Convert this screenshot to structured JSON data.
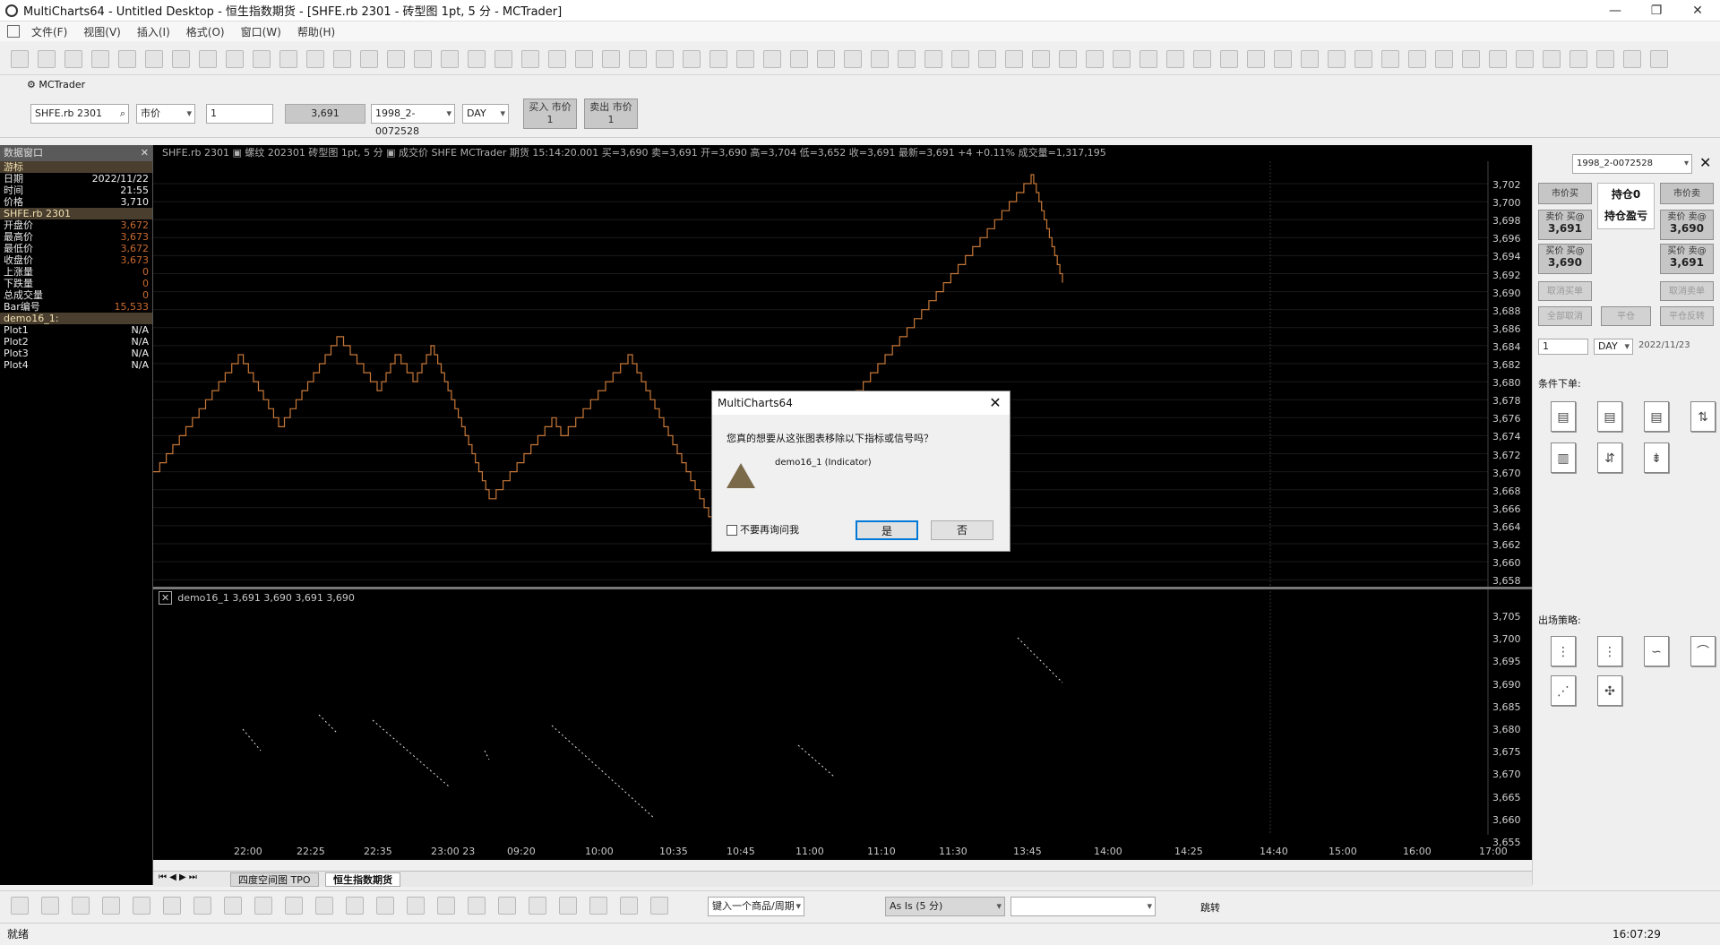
{
  "window": {
    "title": "MultiCharts64 - Untitled Desktop - 恒生指数期货 - [SHFE.rb 2301 - 砖型图 1pt, 5 分 - MCTrader]"
  },
  "menu": [
    "文件(F)",
    "视图(V)",
    "插入(I)",
    "格式(O)",
    "窗口(W)",
    "帮助(H)"
  ],
  "trade_bar": {
    "tab_label": "MCTrader",
    "symbol": "SHFE.rb 2301",
    "order_type": "市价",
    "quantity": "1",
    "price": "3,691",
    "account": "1998_2-0072528",
    "tif": "DAY",
    "buy_label": "买入 市价",
    "buy_qty": "1",
    "sell_label": "卖出 市价",
    "sell_qty": "1"
  },
  "data_window": {
    "title": "数据窗口",
    "rows": [
      {
        "label": "游标",
        "value": "",
        "section": true
      },
      {
        "label": "日期",
        "value": "2022/11/22"
      },
      {
        "label": "时间",
        "value": "21:55"
      },
      {
        "label": "价格",
        "value": "3,710"
      },
      {
        "label": "SHFE.rb 2301",
        "value": "",
        "section": true
      },
      {
        "label": "开盘价",
        "value": "3,672",
        "dim": true
      },
      {
        "label": "最高价",
        "value": "3,673",
        "dim": true
      },
      {
        "label": "最低价",
        "value": "3,672",
        "dim": true
      },
      {
        "label": "收盘价",
        "value": "3,673",
        "dim": true
      },
      {
        "label": "上涨量",
        "value": "0",
        "dim": true
      },
      {
        "label": "下跌量",
        "value": "0",
        "dim": true
      },
      {
        "label": "总成交量",
        "value": "0",
        "dim": true
      },
      {
        "label": "Bar编号",
        "value": "15,533",
        "dim": true
      },
      {
        "label": "demo16_1:",
        "value": "",
        "section": true
      },
      {
        "label": "Plot1",
        "value": "N/A"
      },
      {
        "label": "Plot2",
        "value": "N/A"
      },
      {
        "label": "Plot3",
        "value": "N/A"
      },
      {
        "label": "Plot4",
        "value": "N/A"
      }
    ]
  },
  "chart": {
    "info_text": "SHFE.rb 2301  ▣  螺纹 202301 砖型图 1pt, 5 分  ▣  成交价  SHFE  MCTrader  期货  15:14:20.001  买=3,690  卖=3,691  开=3,690  高=3,704  低=3,652  收=3,691  最新=3,691  +4    +0.11%  成交量=1,317,195",
    "sub_info": "demo16_1   3,691  3,690  3,691  3,690",
    "x_labels": [
      "22:00",
      "22:25",
      "22:35",
      "23:00  23",
      "09:20",
      "10:00",
      "10:35",
      "10:45",
      "11:00",
      "11:10",
      "11:30",
      "13:45",
      "14:00",
      "14:25",
      "14:40",
      "15:00",
      "16:00",
      "17:00"
    ],
    "price_axis_top": [
      "3,702",
      "3,700",
      "3,698",
      "3,696",
      "3,694",
      "3,692",
      "3,690",
      "3,688",
      "3,686",
      "3,684",
      "3,682",
      "3,680",
      "3,678",
      "3,676",
      "3,674",
      "3,672",
      "3,670",
      "3,668",
      "3,666",
      "3,664",
      "3,662",
      "3,660",
      "3,658"
    ],
    "price_axis_bottom": [
      "3,705",
      "3,700",
      "3,695",
      "3,690",
      "3,685",
      "3,680",
      "3,675",
      "3,670",
      "3,665",
      "3,660",
      "3,655"
    ],
    "brick_color": "#c87838",
    "indicator_color": "#e0e0e0"
  },
  "tabs": [
    "四度空间图 TPO",
    "恒生指数期货"
  ],
  "draw_bar": {
    "symbol_input": "键入一个商品/周期",
    "resolution": "As Is (5 分)",
    "jump_label": "跳转"
  },
  "status": {
    "left": "就绪",
    "time": "16:07:29"
  },
  "right_panel": {
    "account": "1998_2-0072528",
    "buy_market": "市价买",
    "position_label": "持仓0",
    "pnl_label": "持仓盈亏",
    "sell_market": "市价卖",
    "sell_bid_label": "卖价 买@",
    "sell_bid_value": "3,691",
    "buy_ask_label": "卖价 卖@",
    "buy_ask_value": "3,690",
    "bid_buy_label": "买价 买@",
    "bid_buy_value": "3,690",
    "bid_sell_label": "买价 卖@",
    "bid_sell_value": "3,691",
    "disabled1": "取消买单",
    "disabled2": "取消卖单",
    "disabled3": "全部取消",
    "disabled4": "平仓",
    "disabled5": "平仓反转",
    "qty": "1",
    "tif": "DAY",
    "date": "2022/11/23",
    "cond_orders": "条件下单:",
    "exit_strategy": "出场策略:"
  },
  "dialog": {
    "title": "MultiCharts64",
    "question": "您真的想要从这张图表移除以下指标或信号吗？",
    "item": "demo16_1 (Indicator)",
    "checkbox": "不要再询问我",
    "yes": "是",
    "no": "否"
  }
}
